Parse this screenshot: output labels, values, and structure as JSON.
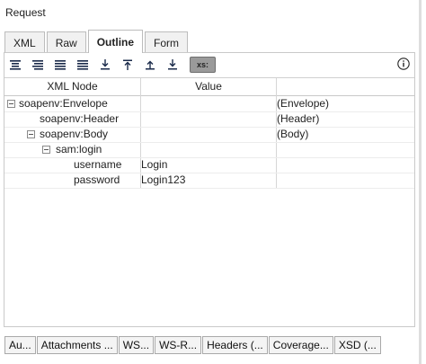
{
  "window": {
    "title": "Request"
  },
  "tabs": [
    {
      "label": "XML",
      "active": false
    },
    {
      "label": "Raw",
      "active": false
    },
    {
      "label": "Outline",
      "active": true
    },
    {
      "label": "Form",
      "active": false
    }
  ],
  "toolbar": {
    "icons": [
      "align-lines-icon",
      "align-lines-icon",
      "align-lines-icon",
      "align-lines-icon",
      "arrow-down-bar-icon",
      "arrow-up-bar-icon",
      "arrow-up-bar-icon",
      "arrow-down-bar-icon"
    ],
    "xs_label": "xs:",
    "info_icon": "info-icon"
  },
  "table": {
    "columns": [
      "XML Node",
      "Value",
      ""
    ],
    "rows": [
      {
        "node": "soapenv:Envelope",
        "value": "",
        "type": "(Envelope)",
        "indent": 0,
        "expandable": true
      },
      {
        "node": "soapenv:Header",
        "value": "",
        "type": "(Header)",
        "indent": 1,
        "expandable": false
      },
      {
        "node": "soapenv:Body",
        "value": "",
        "type": "(Body)",
        "indent": 1,
        "expandable": true
      },
      {
        "node": "sam:login",
        "value": "",
        "type": "",
        "indent": 2,
        "expandable": true
      },
      {
        "node": "username",
        "value": "Login",
        "type": "",
        "indent": 3,
        "expandable": false
      },
      {
        "node": "password",
        "value": "Login123",
        "type": "",
        "indent": 3,
        "expandable": false
      }
    ]
  },
  "bottom_tabs": [
    {
      "label": "Au..."
    },
    {
      "label": "Attachments ..."
    },
    {
      "label": "WS..."
    },
    {
      "label": "WS-R..."
    },
    {
      "label": "Headers (..."
    },
    {
      "label": "Coverage..."
    },
    {
      "label": "XSD (..."
    }
  ],
  "colors": {
    "xs_button": "#9a9a9a",
    "panel_border": "#c9c9c9",
    "tab_bg": "#f1f1f1"
  }
}
